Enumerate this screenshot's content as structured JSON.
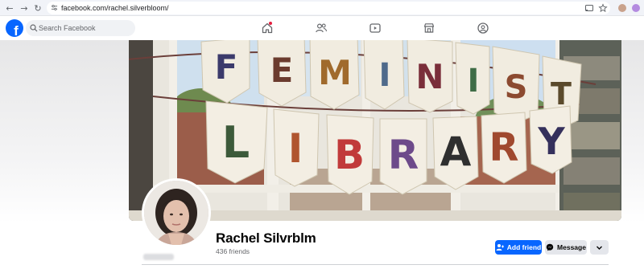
{
  "browser": {
    "url": "facebook.com/rachel.silverbloom/",
    "nav_icons": [
      "back-arrow-icon",
      "forward-arrow-icon",
      "reload-icon"
    ],
    "toolbar_icons": [
      "cast-icon",
      "bookmark-star-icon",
      "extension-avatar-icon",
      "profile-avatar-icon"
    ]
  },
  "facebook": {
    "logo": "f",
    "search_placeholder": "Search Facebook",
    "nav_icons": [
      "home-icon",
      "friends-icon",
      "watch-icon",
      "marketplace-icon",
      "groups-icon"
    ],
    "brand_color": "#0866ff",
    "notification_color": "#e41e3f"
  },
  "cover": {
    "banner_top_letters": [
      "F",
      "E",
      "M",
      "I",
      "N",
      "I",
      "S",
      "T"
    ],
    "banner_bottom_letters": [
      "L",
      "I",
      "B",
      "R",
      "A",
      "R",
      "Y"
    ]
  },
  "profile": {
    "name": "Rachel Silvrblm",
    "friends": "436 friends",
    "add_friend_label": "Add friend",
    "message_label": "Message",
    "more_icon": "chevron-down-icon"
  }
}
